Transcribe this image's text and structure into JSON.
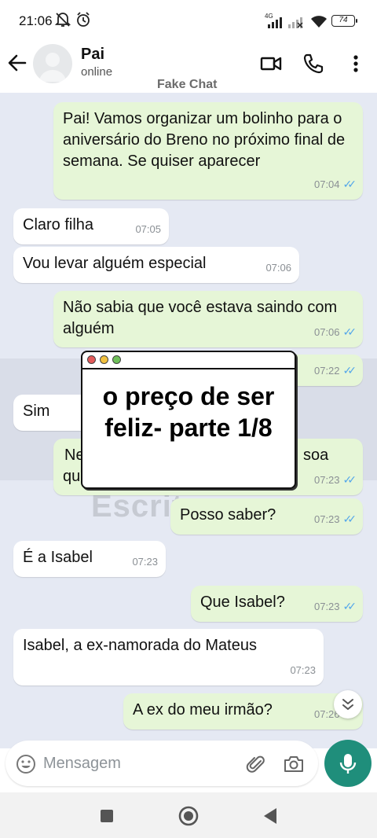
{
  "status_bar": {
    "time": "21:06",
    "network": "4G",
    "battery": "74"
  },
  "header": {
    "name": "Pai",
    "status": "online",
    "watermark": "Fake Chat"
  },
  "messages": [
    {
      "side": "out",
      "text": "Pai! Vamos organizar um bolinho para o aniversário do Breno no próximo final de semana. Se quiser aparecer",
      "time": "07:04",
      "read": true
    },
    {
      "side": "in",
      "text": "Claro filha",
      "time": "07:05"
    },
    {
      "side": "in",
      "text": "Vou levar alguém especial",
      "time": "07:06"
    },
    {
      "side": "out",
      "text": "Não sabia que você estava saindo com alguém",
      "time": "07:06",
      "read": true
    },
    {
      "side": "out",
      "text": "",
      "time": "07:22",
      "read": true
    },
    {
      "side": "in",
      "text": "Sim",
      "time": ""
    },
    {
      "side": "out",
      "text_start": "Ne",
      "text_end": "soa",
      "text_line2": "qu",
      "time": "07:23",
      "read": true
    },
    {
      "side": "out",
      "text": "Posso saber?",
      "time": "07:23",
      "read": true
    },
    {
      "side": "in",
      "text": "É a Isabel",
      "time": "07:23"
    },
    {
      "side": "out",
      "text": "Que Isabel?",
      "time": "07:23",
      "read": true
    },
    {
      "side": "in",
      "text": "Isabel, a ex-namorada do Mateus",
      "time": "07:23"
    },
    {
      "side": "out",
      "text": "A ex do meu irmão?",
      "time": "07:26",
      "read": true
    }
  ],
  "watermark_text": "Escrito",
  "overlay": {
    "title": "o preço de ser feliz- parte 1/8"
  },
  "input": {
    "placeholder": "Mensagem"
  },
  "icons": [
    "back-arrow-icon",
    "video-call-icon",
    "phone-icon",
    "more-vert-icon",
    "emoji-icon",
    "attach-icon",
    "camera-icon",
    "mic-icon",
    "chevron-double-down-icon"
  ],
  "colors": {
    "accent": "#1f8e7b",
    "outgoing_bubble": "#e6f6d7",
    "incoming_bubble": "#ffffff",
    "chat_bg": "#e5e9f3",
    "read_ticks": "#53a6ea"
  }
}
